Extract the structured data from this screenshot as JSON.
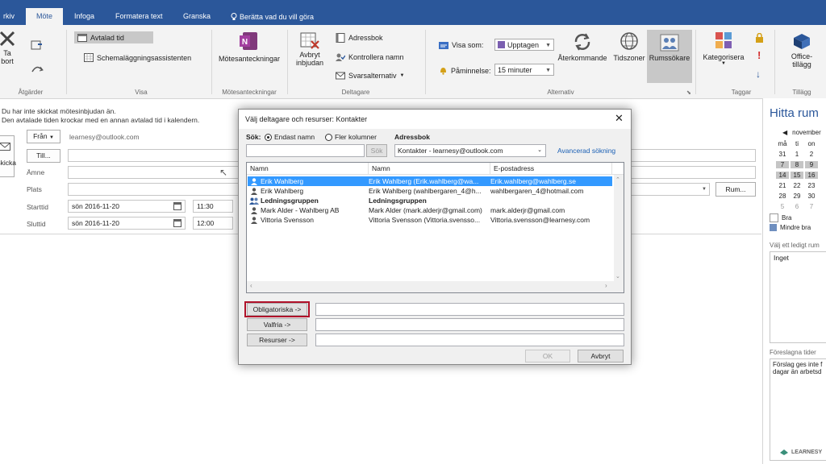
{
  "ribbon_tabs": [
    {
      "label": "rkiv"
    },
    {
      "label": "Möte"
    },
    {
      "label": "Infoga"
    },
    {
      "label": "Formatera text"
    },
    {
      "label": "Granska"
    },
    {
      "label": "Berätta vad du vill göra"
    }
  ],
  "ribbon": {
    "delete": "Ta bort",
    "delete_line1": "Ta",
    "delete_line2": "bort",
    "actions_group": "Åtgärder",
    "appointment": "Avtalad tid",
    "scheduling_assistant": "Schemaläggningsassistenten",
    "view_group": "Visa",
    "meeting_notes": "Mötesanteckningar",
    "meeting_notes_group": "Mötesanteckningar",
    "cancel_invitation_line1": "Avbryt",
    "cancel_invitation_line2": "inbjudan",
    "address_book": "Adressbok",
    "check_names": "Kontrollera namn",
    "response_options": "Svarsalternativ",
    "attendees_group": "Deltagare",
    "show_as_label": "Visa som:",
    "show_as_value": "Upptagen",
    "reminder_label": "Påminnelse:",
    "reminder_value": "15 minuter",
    "recurring": "Återkommande",
    "time_zones": "Tidszoner",
    "room_finder": "Rumssökare",
    "options_group": "Alternativ",
    "categorize": "Kategorisera",
    "tags_group": "Taggar",
    "office_addins_line1": "Office-",
    "office_addins_line2": "tillägg",
    "addins_group": "Tillägg"
  },
  "form": {
    "info_line1": "Du har inte skickat mötesinbjudan än.",
    "info_line2": "Den avtalade tiden krockar med en annan avtalad tid i kalendern.",
    "from_button": "Från",
    "from_value": "learnesy@outlook.com",
    "to_button": "Till...",
    "send_label": "Skicka",
    "subject_label": "Ämne",
    "location_label": "Plats",
    "start_label": "Starttid",
    "start_date": "sön 2016-11-20",
    "start_time": "11:30",
    "end_label": "Sluttid",
    "end_date": "sön 2016-11-20",
    "end_time": "12:00",
    "rooms_button": "Rum..."
  },
  "right_pane": {
    "title": "Hitta rum",
    "month": "november",
    "weekdays": [
      "må",
      "ti",
      "on"
    ],
    "weeks": [
      [
        "31",
        "1",
        "2"
      ],
      [
        "7",
        "8",
        "9"
      ],
      [
        "14",
        "15",
        "16"
      ],
      [
        "21",
        "22",
        "23"
      ],
      [
        "28",
        "29",
        "30"
      ],
      [
        "5",
        "6",
        "7"
      ]
    ],
    "legend_good": "Bra",
    "legend_less_good": "Mindre bra",
    "choose_room_label": "Välj ett ledigt rum",
    "room_value": "Inget",
    "suggested_label": "Föreslagna tider",
    "suggested_text_line1": "Förslag ges inte f",
    "suggested_text_line2": "dagar än arbetsd",
    "watermark": "LEARNESY"
  },
  "dialog": {
    "title": "Välj deltagare och resurser: Kontakter",
    "search_label": "Sök:",
    "radio_names_only": "Endast namn",
    "radio_more_columns": "Fler kolumner",
    "address_book_label": "Adressbok",
    "search_button": "Sök",
    "address_book_value": "Kontakter - learnesy@outlook.com",
    "advanced_search": "Avancerad sökning",
    "columns": [
      "Namn",
      "Namn",
      "E-postadress"
    ],
    "rows": [
      {
        "name": "Erik Wahlberg",
        "display": "Erik Wahlberg (Erik.wahlberg@wa...",
        "email": "Erik.wahlberg@wahlberg.se",
        "group": false
      },
      {
        "name": "Erik Wahlberg",
        "display": "Erik Wahlberg (wahlbergaren_4@h...",
        "email": "wahlbergaren_4@hotmail.com",
        "group": false
      },
      {
        "name": "Ledningsgruppen",
        "display": "Ledningsgruppen",
        "email": "",
        "group": true
      },
      {
        "name": "Mark Alder - Wahlberg AB",
        "display": "Mark Alder (mark.alderjr@gmail.com)",
        "email": "mark.alderjr@gmail.com",
        "group": false
      },
      {
        "name": "Vittoria Svensson",
        "display": "Vittoria Svensson (Vittoria.svensso...",
        "email": "Vittoria.svensson@learnesy.com",
        "group": false
      }
    ],
    "required_button": "Obligatoriska ->",
    "optional_button": "Valfria ->",
    "resources_button": "Resurser ->",
    "ok_button": "OK",
    "cancel_button": "Avbryt"
  },
  "colors": {
    "accent": "#2b579a",
    "selection": "#3399ff",
    "highlight_border": "#c00000"
  }
}
